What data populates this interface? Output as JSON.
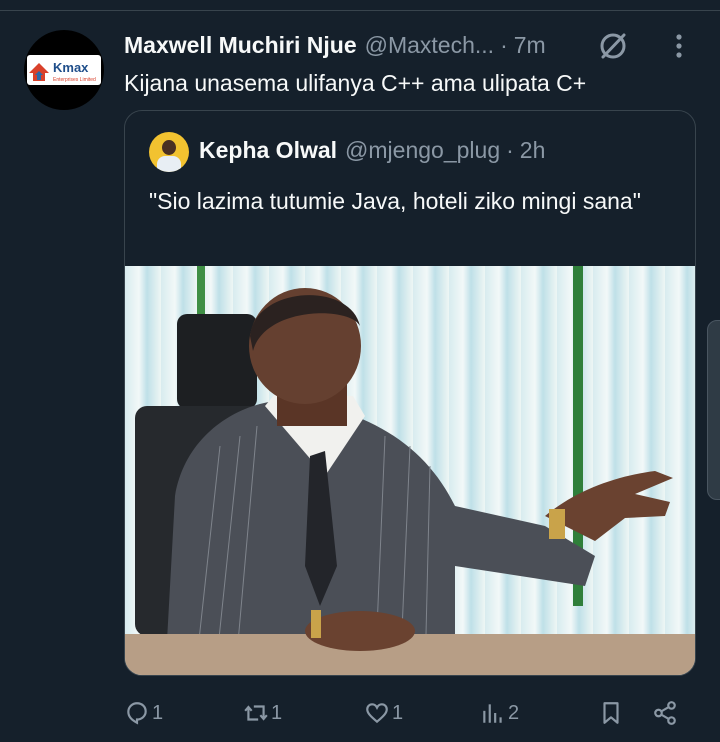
{
  "tweet": {
    "author": {
      "display_name": "Maxwell Muchiri Njue",
      "handle": "@Maxtech...",
      "avatar_logo_text": "Kmax",
      "avatar_logo_subtext": "Enterprises Limited"
    },
    "separator": "·",
    "time": "7m",
    "text": "Kijana unasema ulifanya C++ ama ulipata C+"
  },
  "quoted_tweet": {
    "author": {
      "display_name": "Kepha Olwal",
      "handle": "@mjengo_plug"
    },
    "separator": "·",
    "time": "2h",
    "text": "\"Sio lazima tutumie Java, hoteli ziko mingi sana\""
  },
  "actions": {
    "replies": "1",
    "reposts": "1",
    "likes": "1",
    "views": "2"
  },
  "colors": {
    "background": "#15202b",
    "text_primary": "#f7f9f9",
    "text_secondary": "#8b98a5",
    "border": "#38444d"
  },
  "icons": [
    "grok-icon",
    "more-icon",
    "reply-icon",
    "repost-icon",
    "like-icon",
    "views-icon",
    "bookmark-icon",
    "share-icon"
  ]
}
